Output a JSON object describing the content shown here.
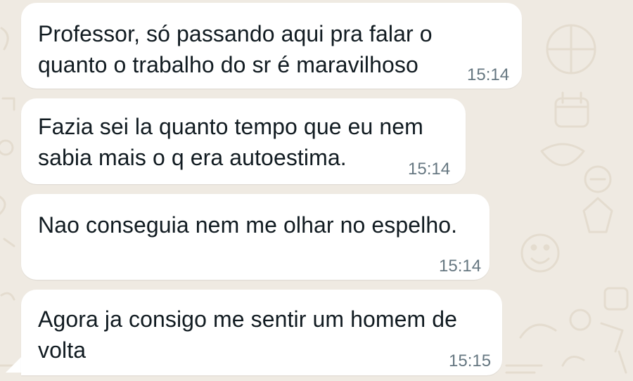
{
  "messages": [
    {
      "text": "Professor, só passando aqui pra falar o\nquanto o trabalho do sr é maravilhoso",
      "time": "15:14"
    },
    {
      "text": "Fazia sei la quanto tempo que eu nem\nsabia mais o q era autoestima.",
      "time": "15:14"
    },
    {
      "text": "Nao conseguia nem me olhar no espelho.",
      "time": "15:14"
    },
    {
      "text": "Agora ja consigo me sentir um homem de\nvolta",
      "time": "15:15"
    }
  ],
  "colors": {
    "background": "#efeae2",
    "bubble": "#ffffff",
    "text": "#111b21",
    "timestamp": "#667781"
  }
}
